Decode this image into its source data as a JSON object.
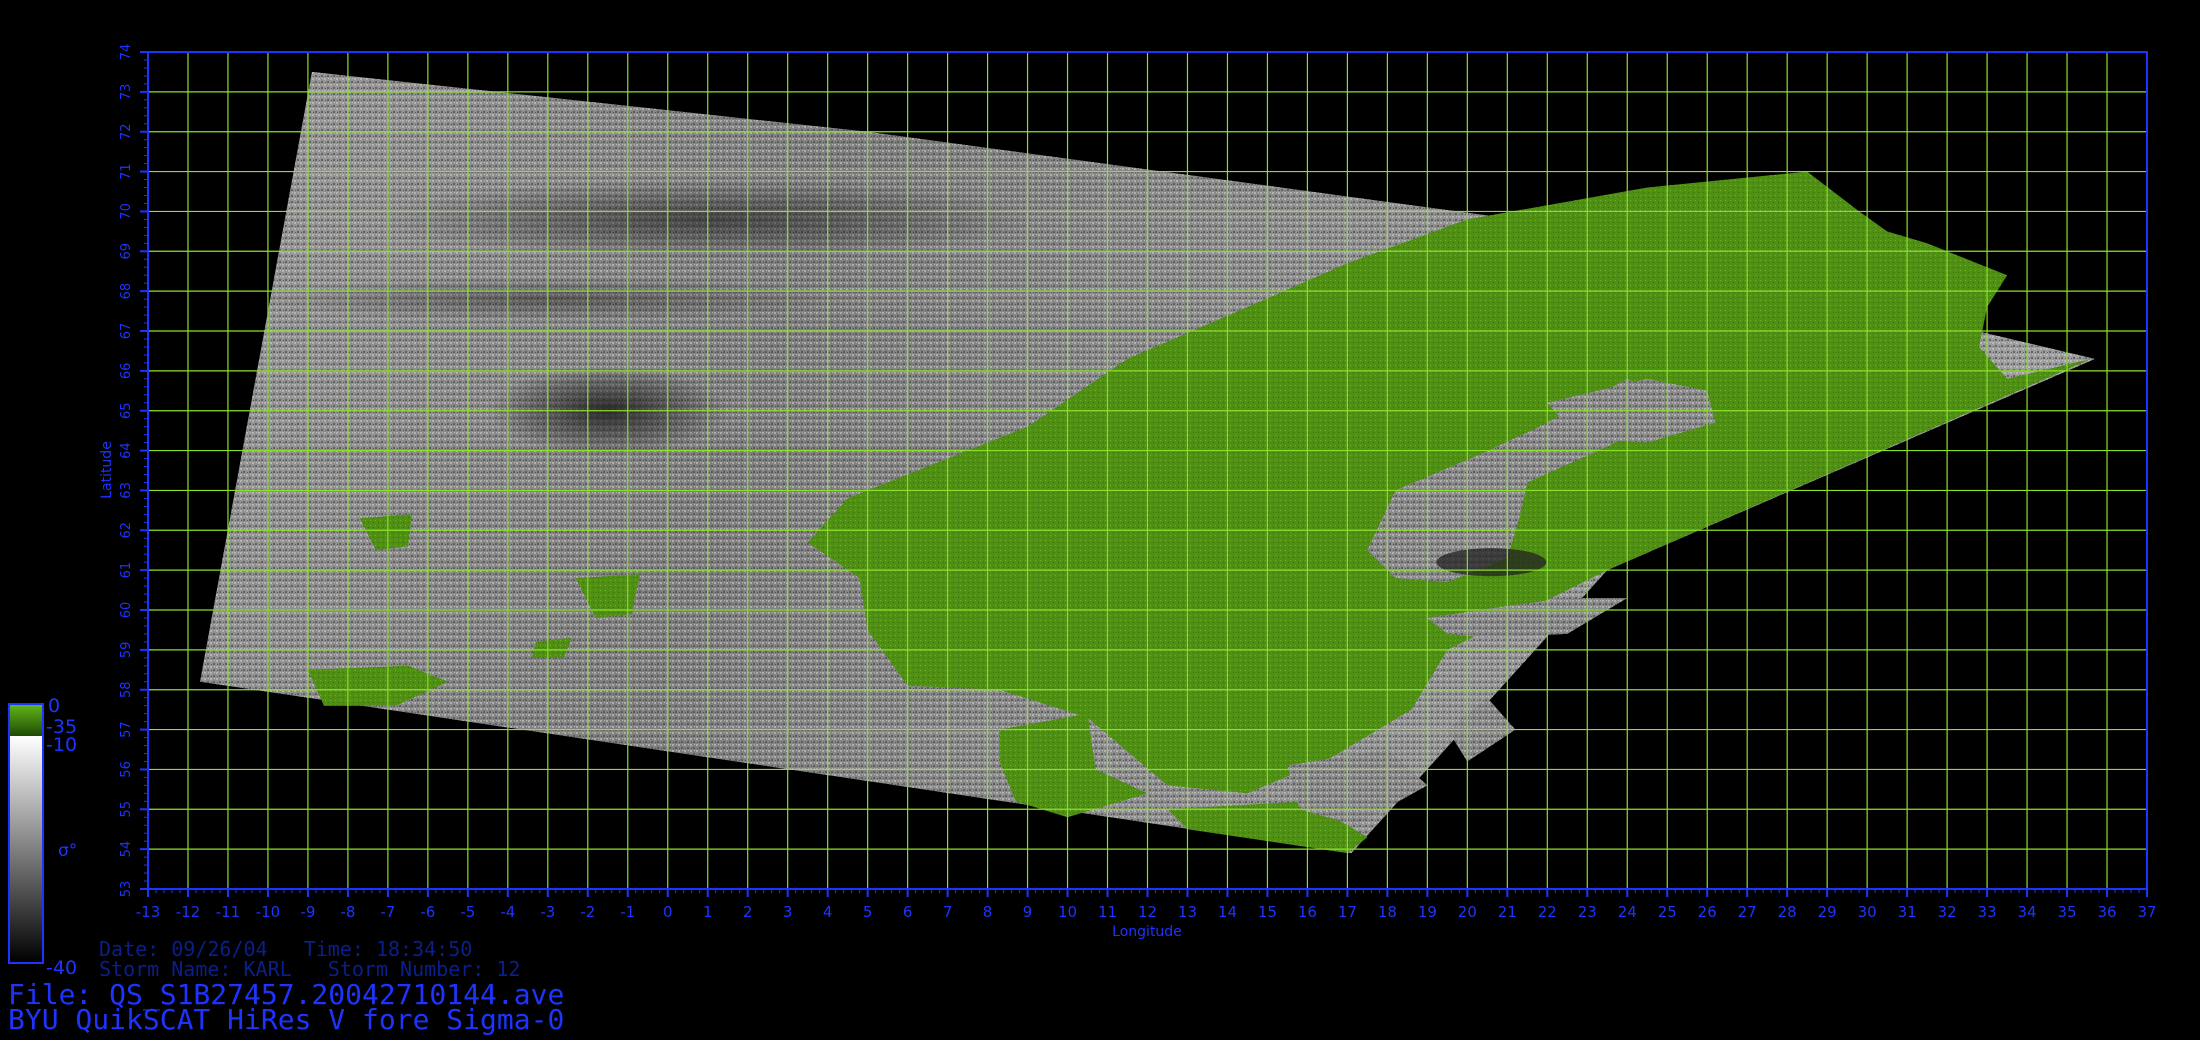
{
  "map": {
    "lon_range": [
      -13,
      37
    ],
    "lat_range": [
      53,
      74
    ],
    "grid_color": "#8be02a",
    "frame_color": "#1d34ff",
    "land_color": "#4f8f14",
    "xlabel": "Longitude",
    "ylabel": "Latitude",
    "lon_ticks": [
      "-13",
      "-12",
      "-11",
      "-10",
      "-9",
      "-8",
      "-7",
      "-6",
      "-5",
      "-4",
      "-3",
      "-2",
      "-1",
      "0",
      "1",
      "2",
      "3",
      "4",
      "5",
      "6",
      "7",
      "8",
      "9",
      "10",
      "11",
      "12",
      "13",
      "14",
      "15",
      "16",
      "17",
      "18",
      "19",
      "20",
      "21",
      "22",
      "23",
      "24",
      "25",
      "26",
      "27",
      "28",
      "29",
      "30",
      "31",
      "32",
      "33",
      "34",
      "35",
      "36",
      "37"
    ],
    "lat_ticks": [
      "53",
      "54",
      "55",
      "56",
      "57",
      "58",
      "59",
      "60",
      "61",
      "62",
      "63",
      "64",
      "65",
      "66",
      "67",
      "68",
      "69",
      "70",
      "71",
      "72",
      "73",
      "74"
    ],
    "swath_corners_lonlat": [
      [
        -8.9,
        73.5
      ],
      [
        5.0,
        72.0
      ],
      [
        20.5,
        69.9
      ],
      [
        35.7,
        66.3
      ],
      [
        23.5,
        61.0
      ],
      [
        17.1,
        53.9
      ],
      [
        -11.7,
        58.2
      ]
    ],
    "land_regions_lonlat": [
      [
        [
          3.5,
          61.7
        ],
        [
          4.5,
          62.8
        ],
        [
          6.0,
          63.4
        ],
        [
          9.0,
          64.6
        ],
        [
          11.5,
          66.3
        ],
        [
          14.5,
          67.6
        ],
        [
          17.0,
          68.7
        ],
        [
          20.0,
          69.8
        ],
        [
          24.5,
          70.6
        ],
        [
          28.5,
          71.0
        ],
        [
          29.8,
          70.0
        ],
        [
          30.5,
          69.5
        ],
        [
          31.5,
          69.2
        ],
        [
          33.5,
          68.4
        ],
        [
          33.0,
          67.6
        ],
        [
          32.8,
          66.6
        ],
        [
          33.5,
          65.8
        ],
        [
          35.6,
          66.3
        ],
        [
          23.5,
          61.0
        ],
        [
          21.5,
          60.0
        ],
        [
          19.5,
          59.0
        ],
        [
          18.6,
          57.5
        ],
        [
          16.6,
          56.3
        ],
        [
          14.5,
          55.4
        ],
        [
          12.5,
          55.6
        ],
        [
          10.5,
          57.3
        ],
        [
          8.3,
          58.0
        ],
        [
          6.0,
          58.1
        ],
        [
          5.0,
          59.5
        ],
        [
          4.8,
          60.8
        ]
      ],
      [
        [
          8.3,
          57.0
        ],
        [
          10.5,
          57.4
        ],
        [
          10.7,
          56.0
        ],
        [
          12.0,
          55.4
        ],
        [
          10.0,
          54.8
        ],
        [
          8.7,
          55.2
        ],
        [
          8.3,
          56.2
        ]
      ],
      [
        [
          17.0,
          53.9
        ],
        [
          13.0,
          54.5
        ],
        [
          12.5,
          55.0
        ],
        [
          16.0,
          55.2
        ],
        [
          17.5,
          54.3
        ]
      ],
      [
        [
          -9.0,
          58.5
        ],
        [
          -6.5,
          58.6
        ],
        [
          -5.5,
          58.2
        ],
        [
          -6.8,
          57.6
        ],
        [
          -8.6,
          57.6
        ]
      ],
      [
        [
          -7.7,
          62.3
        ],
        [
          -6.4,
          62.4
        ],
        [
          -6.5,
          61.6
        ],
        [
          -7.3,
          61.5
        ]
      ],
      [
        [
          -2.3,
          60.8
        ],
        [
          -0.7,
          60.9
        ],
        [
          -0.9,
          59.9
        ],
        [
          -1.8,
          59.8
        ]
      ],
      [
        [
          -3.3,
          59.2
        ],
        [
          -2.4,
          59.3
        ],
        [
          -2.6,
          58.8
        ],
        [
          -3.4,
          58.8
        ]
      ]
    ],
    "water_gray_lonlat": [
      [
        [
          17.5,
          61.5
        ],
        [
          18.2,
          63.0
        ],
        [
          20.3,
          63.9
        ],
        [
          21.8,
          64.6
        ],
        [
          24.0,
          65.8
        ],
        [
          25.3,
          65.1
        ],
        [
          23.5,
          64.1
        ],
        [
          21.5,
          63.2
        ],
        [
          21.3,
          62.3
        ],
        [
          21.0,
          61.3
        ],
        [
          19.5,
          60.7
        ],
        [
          18.2,
          60.8
        ]
      ],
      [
        [
          22.0,
          65.2
        ],
        [
          24.5,
          65.8
        ],
        [
          26.0,
          65.5
        ],
        [
          26.2,
          64.7
        ],
        [
          24.5,
          64.2
        ],
        [
          22.8,
          64.3
        ]
      ],
      [
        [
          19.0,
          59.8
        ],
        [
          21.0,
          60.1
        ],
        [
          22.5,
          60.3
        ],
        [
          24.0,
          60.3
        ],
        [
          22.5,
          59.4
        ],
        [
          20.5,
          59.3
        ],
        [
          19.5,
          59.4
        ]
      ],
      [
        [
          19.5,
          57.0
        ],
        [
          20.5,
          57.8
        ],
        [
          21.2,
          57.0
        ],
        [
          20.0,
          56.2
        ]
      ],
      [
        [
          15.5,
          56.1
        ],
        [
          18.0,
          56.5
        ],
        [
          19.0,
          55.6
        ],
        [
          17.2,
          54.6
        ],
        [
          15.8,
          55.0
        ]
      ]
    ]
  },
  "colorbar": {
    "land_top": "0",
    "land_bottom": "-35",
    "sea_top": "-10",
    "sea_bottom": "-40",
    "symbol": "σ°"
  },
  "info": {
    "line1": "Date: 09/26/04   Time: 18:34:50",
    "line2": "Storm Name: KARL   Storm Number: 12"
  },
  "file": {
    "line1": "File: QS_S1B27457.20042710144.ave",
    "line2": "BYU QuikSCAT HiRes V fore Sigma-0"
  }
}
